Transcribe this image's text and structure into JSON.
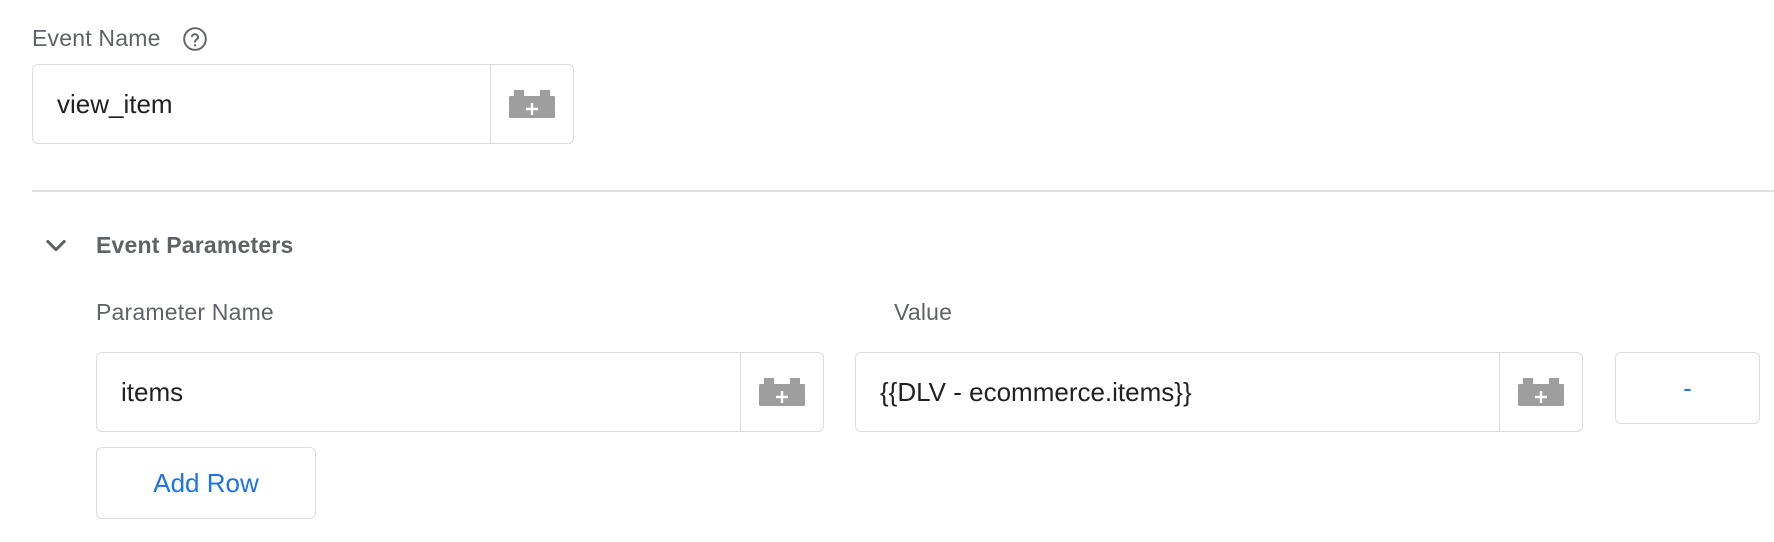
{
  "event_name": {
    "label": "Event Name",
    "value": "view_item",
    "help_icon": "help-circle-icon",
    "variable_icon": "add-variable-brick-icon"
  },
  "event_parameters": {
    "title": "Event Parameters",
    "expanded": true,
    "toggle_icon": "chevron-down-icon",
    "columns": {
      "name_header": "Parameter Name",
      "value_header": "Value"
    },
    "rows": [
      {
        "name": "items",
        "value": "{{DLV - ecommerce.items}}",
        "remove_label": "-"
      }
    ],
    "add_row_label": "Add Row"
  },
  "colors": {
    "accent": "#1a73e8",
    "border": "#dadce0",
    "label": "#5f6368",
    "text": "#202124",
    "icon": "#9e9e9e"
  }
}
